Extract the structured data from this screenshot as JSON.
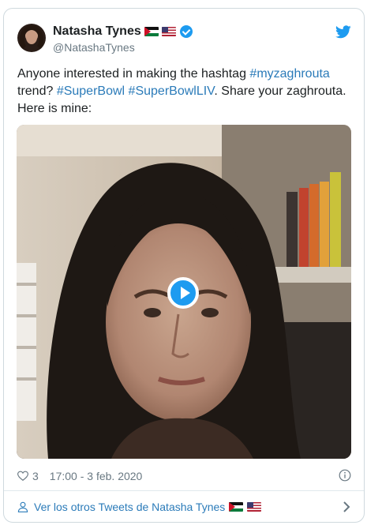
{
  "tweet": {
    "author": {
      "display_name": "Natasha Tynes",
      "handle": "@NatashaTynes",
      "flags": [
        "jordan-flag",
        "us-flag"
      ],
      "verified": true
    },
    "text": {
      "part1": "Anyone interested in making the hashtag ",
      "hashtag1": "#myzaghrouta",
      "part2": " trend? ",
      "hashtag2": "#SuperBowl",
      "part3": " ",
      "hashtag3": "#SuperBowlLIV",
      "part4": ".  Share your zaghrouta. Here is mine:"
    },
    "likes": "3",
    "timestamp": "17:00 - 3 feb. 2020"
  },
  "footer": {
    "label": "Ver los otros Tweets de Natasha Tynes"
  },
  "icons": {
    "brand": "twitter-bird-icon",
    "play": "play-icon",
    "like": "heart-icon",
    "info": "info-icon",
    "profile": "person-icon",
    "more": "chevron-right-icon"
  },
  "colors": {
    "link": "#2b7bb9",
    "brand": "#1d9bf0",
    "muted": "#697882"
  }
}
